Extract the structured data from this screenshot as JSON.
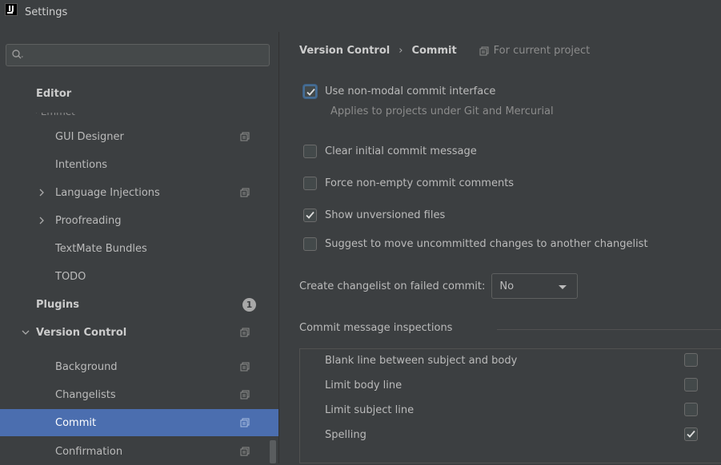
{
  "window": {
    "title": "Settings",
    "app_icon_text": "IJ"
  },
  "search": {
    "placeholder": "",
    "value": ""
  },
  "sidebar": {
    "items": [
      {
        "label": "Editor",
        "bold": true
      },
      {
        "label": "GUI Designer",
        "project_scope": true
      },
      {
        "label": "Intentions"
      },
      {
        "label": "Language Injections",
        "expandable": true,
        "project_scope": true
      },
      {
        "label": "Proofreading",
        "expandable": true
      },
      {
        "label": "TextMate Bundles"
      },
      {
        "label": "TODO"
      },
      {
        "label": "Plugins",
        "bold": true,
        "badge": "1"
      },
      {
        "label": "Version Control",
        "bold": true,
        "expanded": true,
        "project_scope": true
      },
      {
        "label": "Background",
        "project_scope": true
      },
      {
        "label": "Changelists",
        "project_scope": true
      },
      {
        "label": "Commit",
        "selected": true,
        "project_scope": true
      },
      {
        "label": "Confirmation",
        "project_scope": true
      }
    ]
  },
  "breadcrumb": {
    "parent": "Version Control",
    "separator": "›",
    "current": "Commit",
    "scope": "For current project"
  },
  "options": {
    "non_modal": {
      "label": "Use non-modal commit interface",
      "checked": true,
      "hint": "Applies to projects under Git and Mercurial"
    },
    "clear_message": {
      "label": "Clear initial commit message",
      "checked": false
    },
    "force_comments": {
      "label": "Force non-empty commit comments",
      "checked": false
    },
    "show_unversioned": {
      "label": "Show unversioned files",
      "checked": true
    },
    "suggest_move": {
      "label": "Suggest to move uncommitted changes to another changelist",
      "checked": false
    }
  },
  "create_changelist": {
    "label": "Create changelist on failed commit:",
    "selected": "No"
  },
  "inspections": {
    "title": "Commit message inspections",
    "items": [
      {
        "label": "Blank line between subject and body",
        "checked": false
      },
      {
        "label": "Limit body line",
        "checked": false
      },
      {
        "label": "Limit subject line",
        "checked": false
      },
      {
        "label": "Spelling",
        "checked": true
      }
    ]
  },
  "colors": {
    "selection": "#4b6eaf",
    "background": "#3c3f41",
    "text": "#bbbbbb"
  }
}
